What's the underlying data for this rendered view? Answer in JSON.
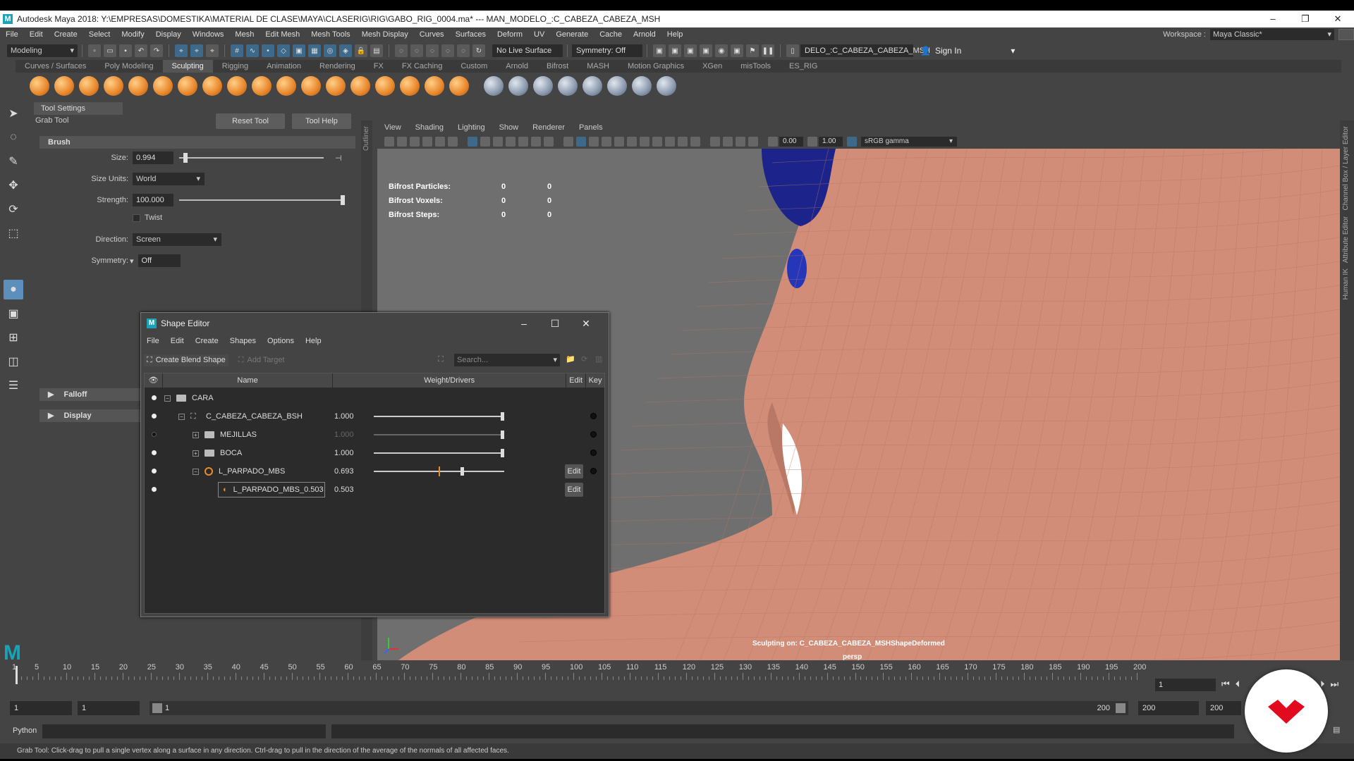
{
  "window": {
    "title": "Autodesk Maya 2018: Y:\\EMPRESAS\\DOMESTIKA\\MATERIAL DE CLASE\\MAYA\\CLASERIG\\RIG\\GABO_RIG_0004.ma*   ---   MAN_MODELO_:C_CABEZA_CABEZA_MSH"
  },
  "menu": [
    "File",
    "Edit",
    "Create",
    "Select",
    "Modify",
    "Display",
    "Windows",
    "Mesh",
    "Edit Mesh",
    "Mesh Tools",
    "Mesh Display",
    "Curves",
    "Surfaces",
    "Deform",
    "UV",
    "Generate",
    "Cache",
    "Arnold",
    "Help"
  ],
  "workspace": {
    "label": "Workspace :",
    "value": "Maya Classic*"
  },
  "status": {
    "mode": "Modeling",
    "live_surface": "No Live Surface",
    "symmetry": "Symmetry: Off",
    "object": "DELO_:C_CABEZA_CABEZA_MSH",
    "sign_in": "Sign In"
  },
  "shelf_tabs": [
    "Curves / Surfaces",
    "Poly Modeling",
    "Sculpting",
    "Rigging",
    "Animation",
    "Rendering",
    "FX",
    "FX Caching",
    "Custom",
    "Arnold",
    "Bifrost",
    "MASH",
    "Motion Graphics",
    "XGen",
    "misTools",
    "ES_RIG"
  ],
  "tool_settings": {
    "tab": "Tool Settings",
    "tool_name": "Grab Tool",
    "reset": "Reset Tool",
    "help": "Tool Help",
    "brush_section": "Brush",
    "size_label": "Size:",
    "size": "0.994",
    "units_label": "Size Units:",
    "units": "World",
    "strength_label": "Strength:",
    "strength": "100.000",
    "twist": "Twist",
    "direction_label": "Direction:",
    "direction": "Screen",
    "symmetry_label": "Symmetry:",
    "symmetry": "Off",
    "falloff": "Falloff",
    "display": "Display",
    "size_level": 0.03,
    "strength_level": 1.0
  },
  "outliner_label": "Outliner",
  "viewport": {
    "menu": [
      "View",
      "Shading",
      "Lighting",
      "Show",
      "Renderer",
      "Panels"
    ],
    "near": "0.00",
    "far": "1.00",
    "color_space": "sRGB gamma",
    "hud": [
      {
        "k": "Bifrost Particles:",
        "a": "0",
        "b": "0"
      },
      {
        "k": "Bifrost Voxels:",
        "a": "0",
        "b": "0"
      },
      {
        "k": "Bifrost Steps:",
        "a": "0",
        "b": "0"
      }
    ],
    "sculpt_msg": "Sculpting on: C_CABEZA_CABEZA_MSHShapeDeformed",
    "camera": "persp",
    "skin_color": "#d28d78"
  },
  "right_strip": [
    "Channel Box / Layer Editor",
    "Attribute Editor",
    "Human IK"
  ],
  "shape_editor": {
    "title": "Shape Editor",
    "menu": [
      "File",
      "Edit",
      "Create",
      "Shapes",
      "Options",
      "Help"
    ],
    "create_blend": "Create Blend Shape",
    "add_target": "Add Target",
    "search_placeholder": "Search...",
    "cols": {
      "name": "Name",
      "weight": "Weight/Drivers",
      "edit": "Edit",
      "key": "Key"
    },
    "rows": [
      {
        "name": "CARA",
        "weight": "",
        "level": 0,
        "vis": true
      },
      {
        "name": "C_CABEZA_CABEZA_BSH",
        "weight": "1.000",
        "level": 1,
        "vis": true,
        "w": 1.0
      },
      {
        "name": "MEJILLAS",
        "weight": "1.000",
        "level": 2,
        "vis": false,
        "w": 1.0
      },
      {
        "name": "BOCA",
        "weight": "1.000",
        "level": 2,
        "vis": true,
        "w": 1.0
      },
      {
        "name": "L_PARPADO_MBS",
        "weight": "0.693",
        "level": 2,
        "vis": true,
        "w": 0.693,
        "edit": "Edit"
      },
      {
        "name": "L_PARPADO_MBS_0.503",
        "weight": "0.503",
        "level": 3,
        "vis": true,
        "edit": "Edit"
      }
    ]
  },
  "timeline": {
    "start": 1,
    "end": 200,
    "ticks": [
      1,
      5,
      10,
      15,
      20,
      25,
      30,
      35,
      40,
      45,
      50,
      55,
      60,
      65,
      70,
      75,
      80,
      85,
      90,
      95,
      100,
      105,
      110,
      115,
      120,
      125,
      130,
      135,
      140,
      145,
      150,
      155,
      160,
      165,
      170,
      175,
      180,
      185,
      190,
      195,
      200
    ],
    "current": "1"
  },
  "range": {
    "start1": "1",
    "start2": "1",
    "inner_start": "1",
    "inner_end": "200",
    "end1": "200",
    "end2": "200"
  },
  "command": {
    "label": "Python"
  },
  "help_line": "Grab Tool: Click-drag to pull a single vertex along a surface in any direction. Ctrl-drag to pull in the direction of the average of the normals of all affected faces."
}
